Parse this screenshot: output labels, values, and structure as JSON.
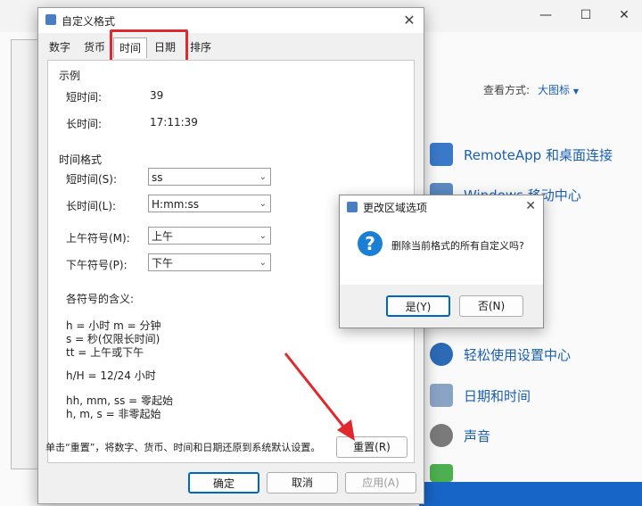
{
  "background_window": {
    "view_by_label": "查看方式:",
    "view_by_value": "大图标",
    "items": [
      {
        "label": "RemoteApp 和桌面连接",
        "icon": "remote-desktop-icon",
        "color": "#3a78c8"
      },
      {
        "label": "Windows 移动中心",
        "icon": "mobility-center-icon",
        "color": "#5a8ac0"
      },
      {
        "label": "轻松使用设置中心",
        "icon": "ease-of-access-icon",
        "color": "#2c6ab6"
      },
      {
        "label": "日期和时间",
        "icon": "date-time-icon",
        "color": "#8aa4c4"
      },
      {
        "label": "声音",
        "icon": "sound-icon",
        "color": "#7a7a7a"
      }
    ]
  },
  "dialog": {
    "title": "自定义格式",
    "tabs": [
      {
        "label": "数字",
        "active": false
      },
      {
        "label": "货币",
        "active": false
      },
      {
        "label": "时间",
        "active": true
      },
      {
        "label": "日期",
        "active": false
      },
      {
        "label": "排序",
        "active": false
      }
    ],
    "sample": {
      "group_label": "示例",
      "short_time_label": "短时间:",
      "short_time_value": "39",
      "long_time_label": "长时间:",
      "long_time_value": "17:11:39"
    },
    "time_format": {
      "group_label": "时间格式",
      "short_time_label": "短时间(S):",
      "short_time_value": "ss",
      "long_time_label": "长时间(L):",
      "long_time_value": "H:mm:ss",
      "am_label": "上午符号(M):",
      "am_value": "上午",
      "pm_label": "下午符号(P):",
      "pm_value": "下午"
    },
    "legend": {
      "heading": "各符号的含义:",
      "line1": "h = 小时   m = 分钟",
      "line2": "s = 秒(仅限长时间)",
      "line3": "tt = 上午或下午",
      "line4": "h/H = 12/24 小时",
      "line5": "hh, mm, ss = 零起始",
      "line6": "h, m, s = 非零起始"
    },
    "reset_hint": "单击“重置”，将数字、货币、时间和日期还原到系统默认设置。",
    "reset_button": "重置(R)",
    "ok_button": "确定",
    "cancel_button": "取消",
    "apply_button": "应用(A)"
  },
  "message_box": {
    "title": "更改区域选项",
    "text": "删除当前格式的所有自定义吗?",
    "yes_button": "是(Y)",
    "no_button": "否(N)"
  },
  "colors": {
    "highlight": "#e0292f",
    "arrow": "#e0292f",
    "accent": "#0067c0"
  }
}
